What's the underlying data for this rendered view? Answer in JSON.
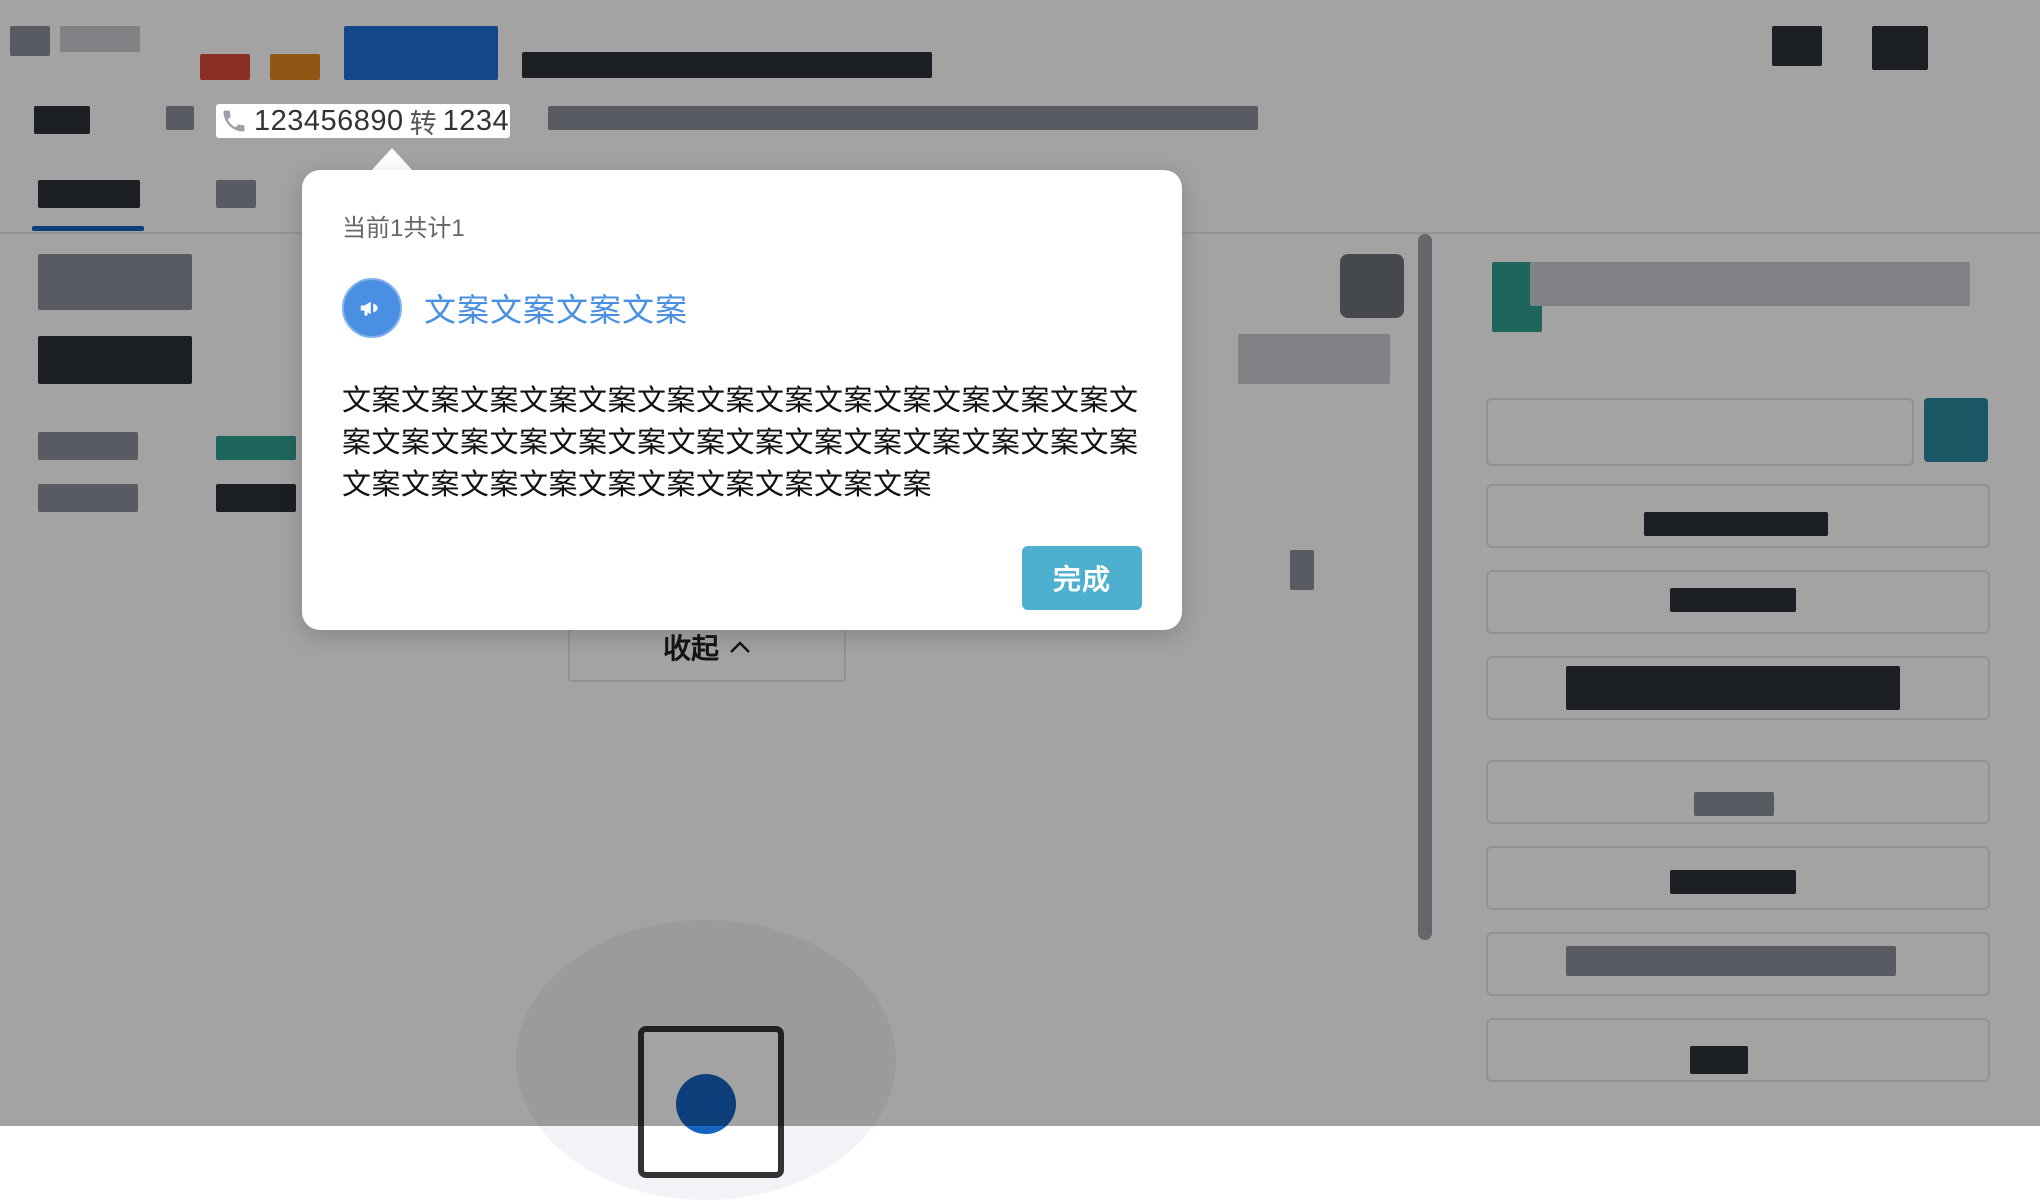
{
  "header": {
    "phone_number": "123456890",
    "phone_extension_separator": "转",
    "phone_extension": "1234"
  },
  "background": {
    "collapse_label": "收起"
  },
  "popover": {
    "counter": "当前1共计1",
    "title": "文案文案文案文案",
    "body": "文案文案文案文案文案文案文案文案文案文案文案文案文案文案文案文案文案文案文案文案文案文案文案文案文案文案文案文案文案文案文案文案文案文案文案文案文案",
    "done_label": "完成"
  },
  "colors": {
    "accent_blue": "#4a90e2",
    "done_button": "#4db0cf"
  }
}
